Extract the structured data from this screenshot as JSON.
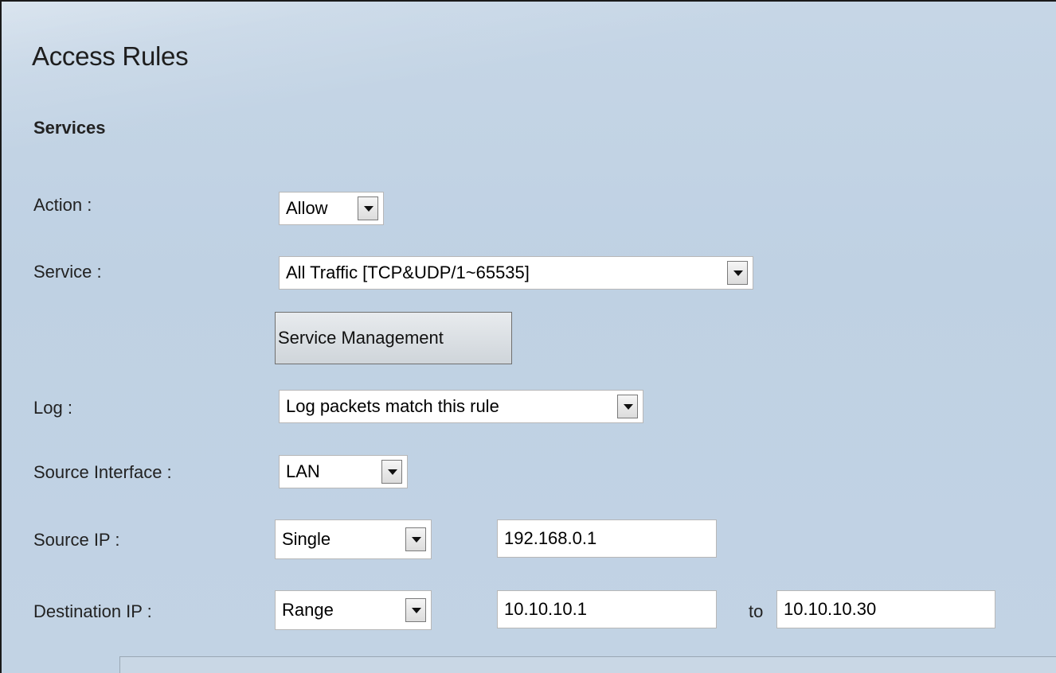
{
  "page": {
    "title": "Access Rules",
    "section_title": "Services"
  },
  "form": {
    "action": {
      "label": "Action :",
      "value": "Allow"
    },
    "service": {
      "label": "Service :",
      "value": "All Traffic [TCP&UDP/1~65535]"
    },
    "service_management_button": "Service Management",
    "log": {
      "label": "Log :",
      "value": "Log packets match this rule"
    },
    "source_interface": {
      "label": "Source Interface :",
      "value": "LAN"
    },
    "source_ip": {
      "label": "Source IP :",
      "type": "Single",
      "address": "192.168.0.1"
    },
    "destination_ip": {
      "label": "Destination IP :",
      "type": "Range",
      "from": "10.10.10.1",
      "to_label": "to",
      "to": "10.10.10.30"
    }
  },
  "colors": {
    "background": "#c2d3e4",
    "field_background": "#ffffff",
    "text": "#222222"
  }
}
